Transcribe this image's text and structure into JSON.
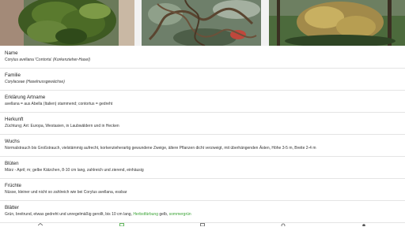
{
  "icons": {
    "photo1": "hazel-tree-photo",
    "photo2": "twisted-branches-photo",
    "photo3": "catkins-photo",
    "nav": [
      "home-icon",
      "plant-icon",
      "image-icon",
      "search-icon",
      "settings-icon"
    ]
  },
  "colors": {
    "accent_green": "#3aa335",
    "divider": "#e4e4e4"
  },
  "fields": {
    "name": {
      "label": "Name",
      "value_main": "Corylus avellana 'Contorta'",
      "value_german": "(Korkenzieher-Hasel)"
    },
    "familie": {
      "label": "Familie",
      "value": "Corylaceae (Haselnussgewächse)"
    },
    "artname": {
      "label": "Erklärung Artname",
      "value": "avellana = aus Abella (Italien) stammend; contortus = gedreht"
    },
    "herkunft": {
      "label": "Herkunft",
      "value": "Züchtung; Art: Europa, Westasien, in Laubwäldern und in Hecken"
    },
    "wuchs": {
      "label": "Wuchs",
      "value": "Normalstrauch bis Großstrauch, vielstämmig aufrecht, korkenzieherartig gewundene Zweige, ältere Pflanzen dicht verzweigt, mit überhängenden Ästen, Höhe 3-5 m, Breite 2-4 m"
    },
    "blueten": {
      "label": "Blüten",
      "value": "März - April; m; gelbe Kätzchen, 8-10 cm lang, zahlreich und zierend, einhäusig"
    },
    "fruechte": {
      "label": "Früchte",
      "value": "Nüsse, kleiner und nicht so zahlreich wie bei Corylus avellana, essbar"
    },
    "blaetter": {
      "label": "Blätter",
      "value_prefix": "Grün, breitrund, etwas gedreht und unregelmäßig gerollt, bis 10 cm lang,",
      "value_link1": "Herbstfärbung",
      "value_mid": "gelb,",
      "value_link2": "sommergrün"
    }
  }
}
